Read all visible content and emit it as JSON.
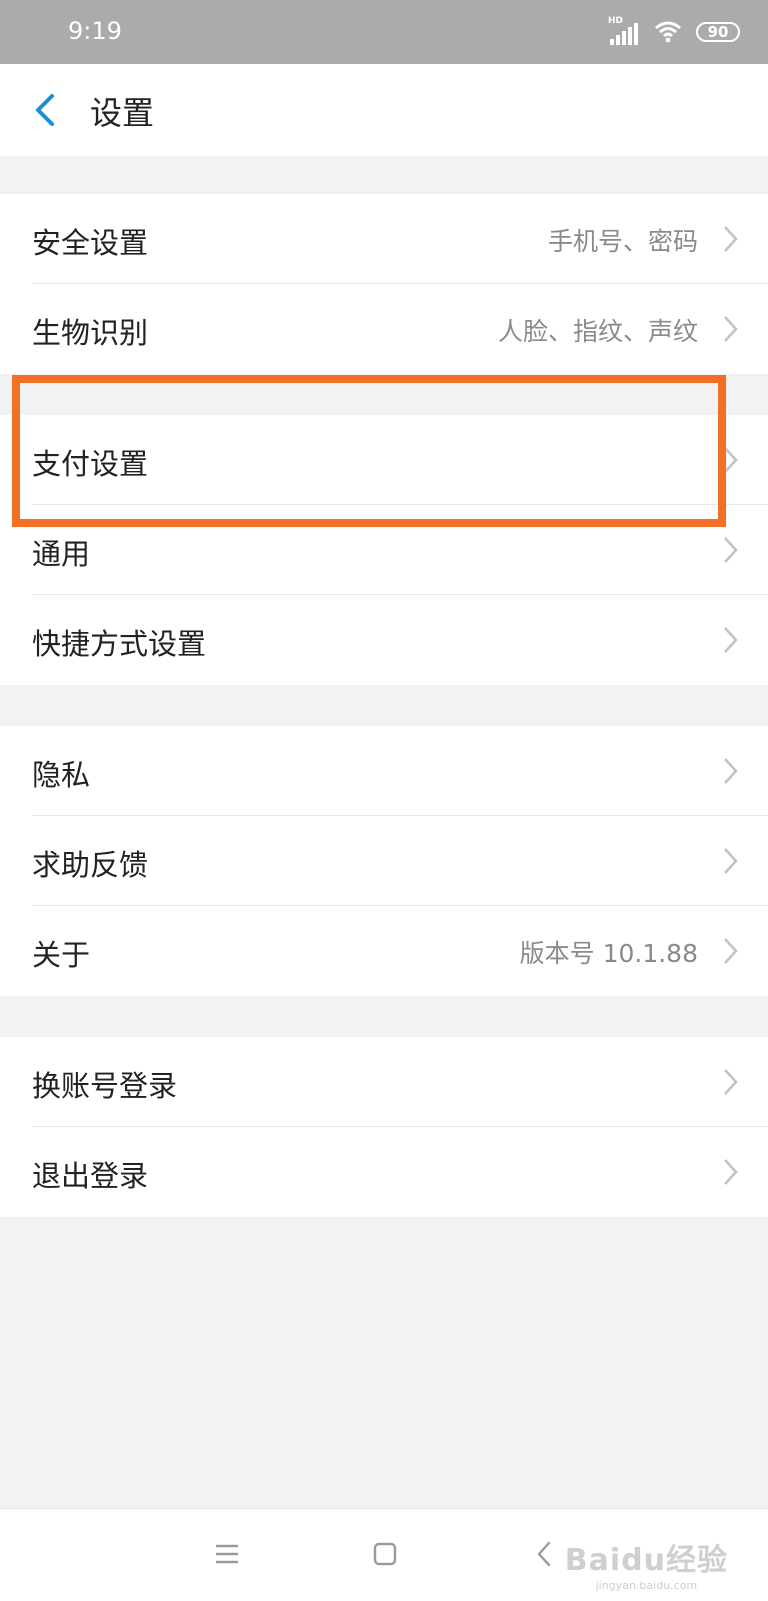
{
  "status_bar": {
    "time": "9:19",
    "hd_label": "HD",
    "battery": "90",
    "icons": [
      "signal-icon",
      "wifi-icon",
      "battery-icon"
    ]
  },
  "header": {
    "back_icon": "chevron-left-icon",
    "title": "设置"
  },
  "groups": [
    [
      {
        "label": "安全设置",
        "value": "手机号、密码"
      },
      {
        "label": "生物识别",
        "value": "人脸、指纹、声纹"
      }
    ],
    [
      {
        "label": "支付设置",
        "value": ""
      },
      {
        "label": "通用",
        "value": ""
      },
      {
        "label": "快捷方式设置",
        "value": ""
      }
    ],
    [
      {
        "label": "隐私",
        "value": ""
      },
      {
        "label": "求助反馈",
        "value": ""
      },
      {
        "label": "关于",
        "value": "版本号 10.1.88"
      }
    ],
    [
      {
        "label": "换账号登录",
        "value": ""
      },
      {
        "label": "退出登录",
        "value": ""
      }
    ]
  ],
  "nav_bar": {
    "icons": [
      "menu-icon",
      "home-icon",
      "back-icon"
    ]
  },
  "watermark": {
    "main": "Baidu经验",
    "sub": "jingyan.baidu.com"
  },
  "colors": {
    "accent": "#1a8fd8",
    "highlight": "#f27025",
    "status_bar": "#ababab"
  }
}
